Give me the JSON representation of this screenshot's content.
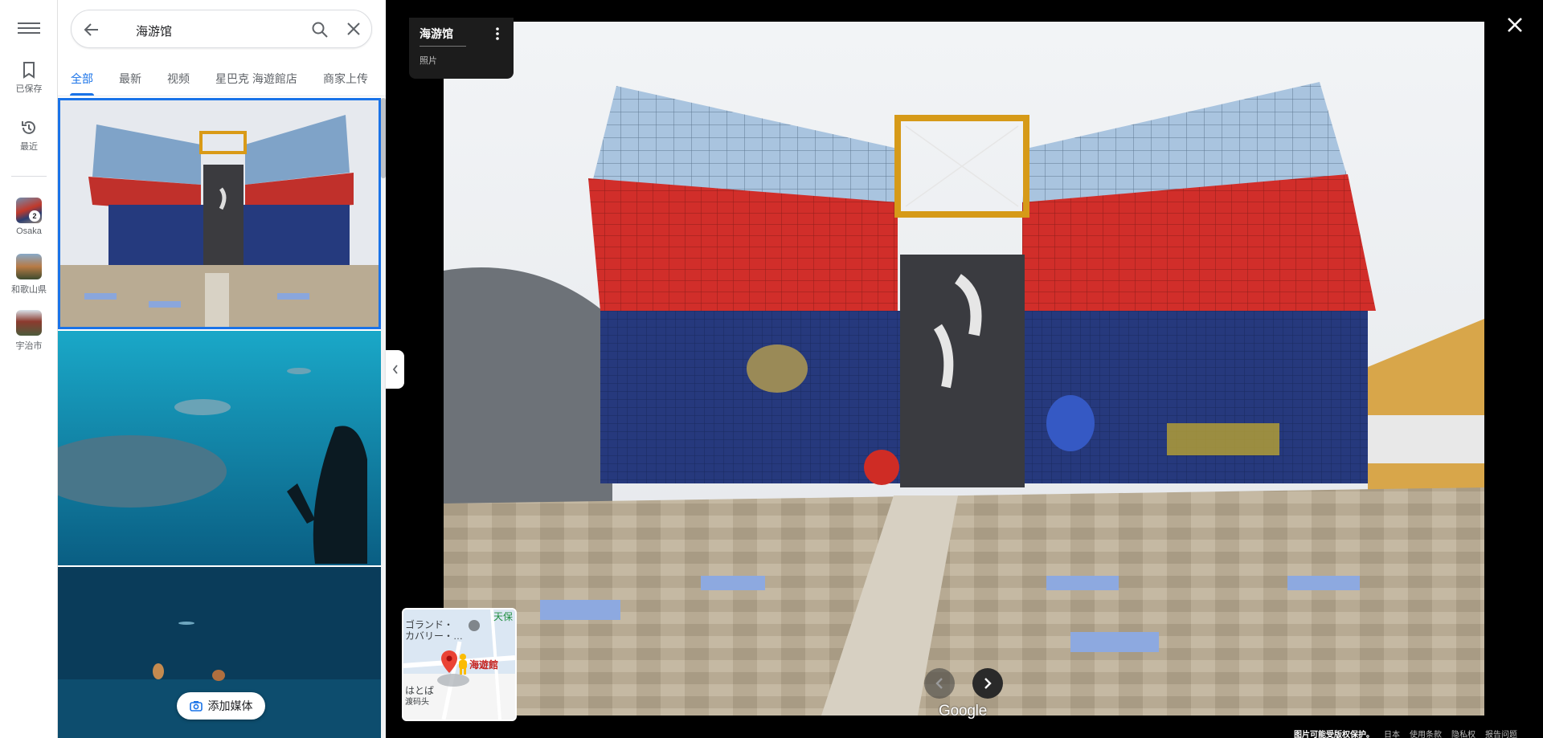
{
  "rail": {
    "saved_label": "已保存",
    "recent_label": "最近",
    "places": [
      {
        "label": "Osaka",
        "badge": "2"
      },
      {
        "label": "和歌山県"
      },
      {
        "label": "宇治市"
      }
    ]
  },
  "search": {
    "query": "海游馆"
  },
  "tabs": [
    "全部",
    "最新",
    "视频",
    "星巴克 海遊館店",
    "商家上传"
  ],
  "panel": {
    "add_media_label": "添加媒体"
  },
  "viewer": {
    "place_name": "海游馆",
    "media_kind": "照片",
    "attribution": "Google"
  },
  "minimap": {
    "labels": [
      "ゴランド・",
      "カバリー・…",
      "天保",
      "海遊館",
      "はとば",
      "渡码头"
    ]
  },
  "footer": {
    "copyright_notice": "图片可能受版权保护。",
    "region": "日本",
    "terms": "使用条款",
    "privacy": "隐私权",
    "report": "报告问题"
  },
  "colors": {
    "accent": "#1a73e8",
    "viewer_bg": "#000000",
    "pin": "#ea4335"
  }
}
